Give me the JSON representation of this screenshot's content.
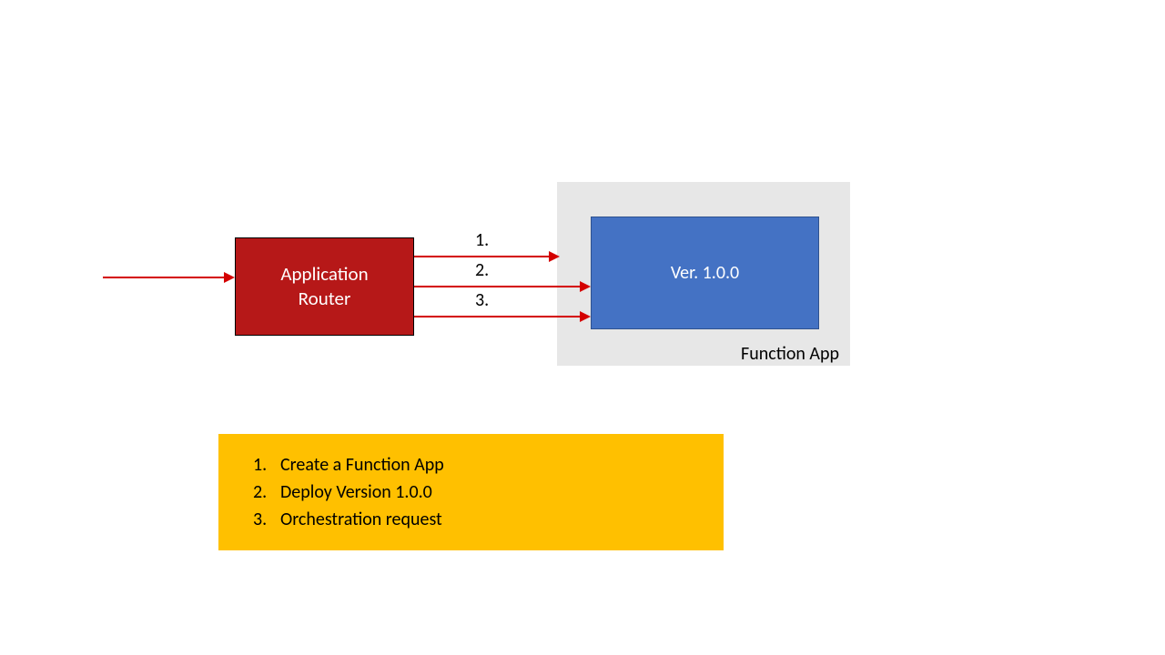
{
  "router": {
    "line1": "Application",
    "line2": "Router"
  },
  "container": {
    "label": "Function App"
  },
  "version": {
    "label": "Ver. 1.0.0"
  },
  "arrows": {
    "label1": "1.",
    "label2": "2.",
    "label3": "3."
  },
  "legend": {
    "n1": "1.",
    "t1": "Create a Function App",
    "n2": "2.",
    "t2": "Deploy Version 1.0.0",
    "n3": "3.",
    "t3": "Orchestration request"
  },
  "colors": {
    "routerFill": "#b61818",
    "versionFill": "#4472c4",
    "versionBorder": "#2f528f",
    "containerFill": "#e7e7e7",
    "legendFill": "#ffc000",
    "arrow": "#d40000"
  }
}
